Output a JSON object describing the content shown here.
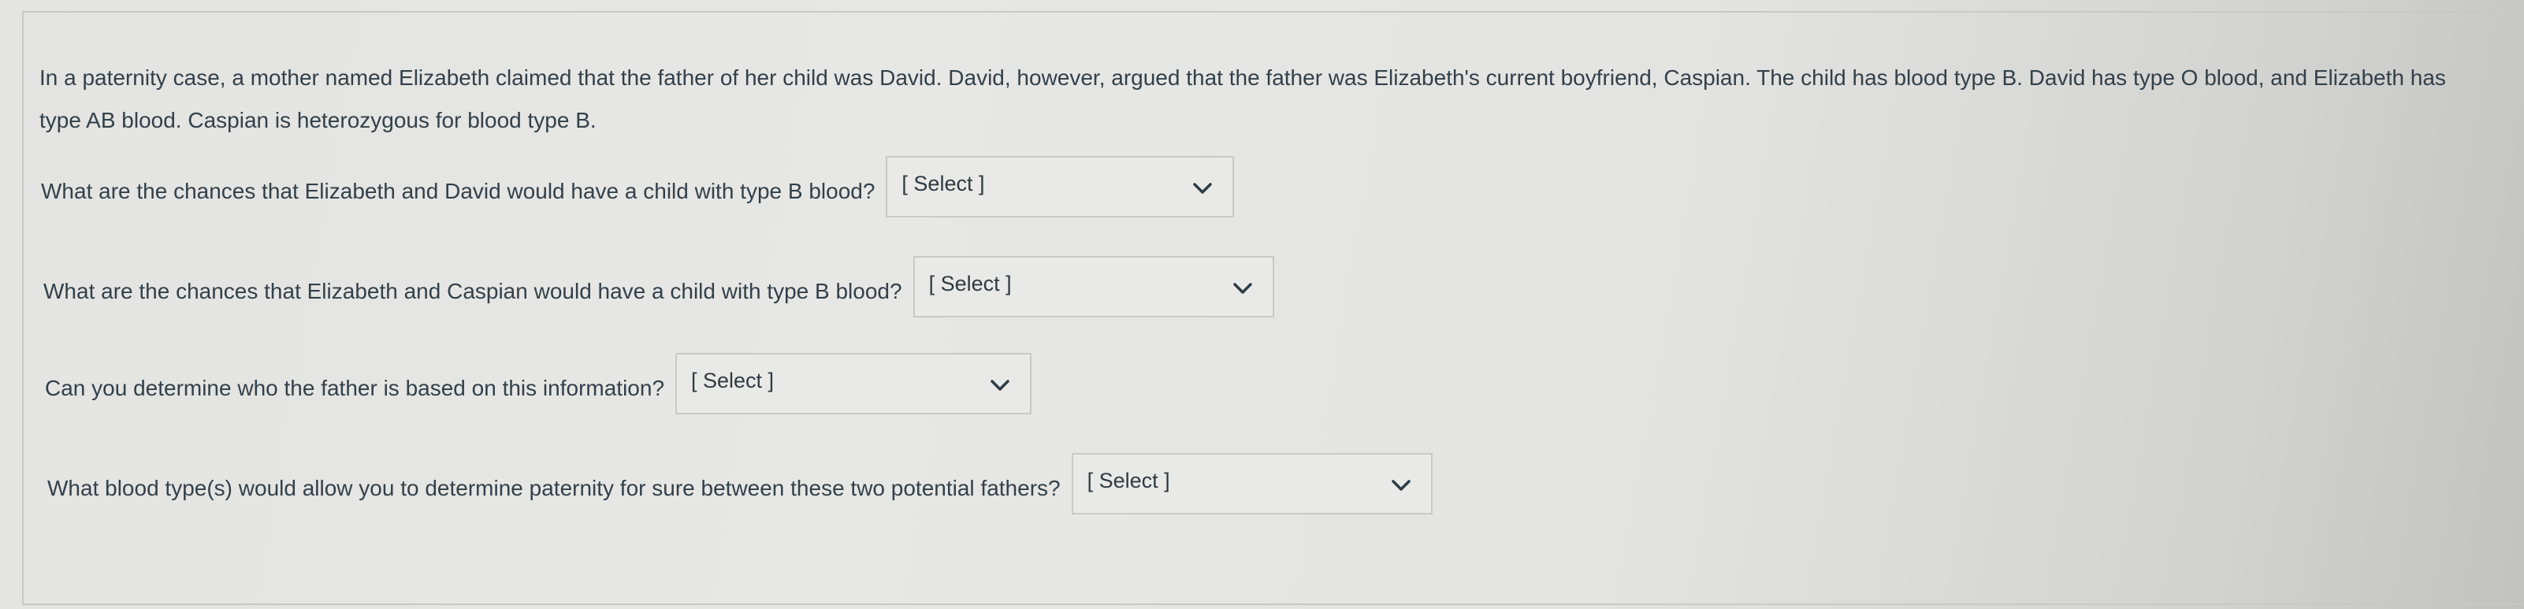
{
  "question": {
    "prompt": "In a paternity case, a mother named Elizabeth claimed that the father of her child was David. David, however, argued that the father was Elizabeth's current boyfriend, Caspian. The child has blood type B. David has type O blood, and Elizabeth has type AB blood. Caspian is heterozygous for blood type B.",
    "items": [
      {
        "text": "What are the chances that Elizabeth and David would have a child with type B blood?",
        "selected": "[ Select ]"
      },
      {
        "text": "What are the chances that Elizabeth and Caspian would have a child with type B blood?",
        "selected": "[ Select ]"
      },
      {
        "text": "Can you determine who the father is based on this information?",
        "selected": "[ Select ]"
      },
      {
        "text": "What blood type(s) would allow you to determine paternity for sure between these two potential fathers?",
        "selected": "[ Select ]"
      }
    ]
  },
  "icons": {
    "dropdown": "chevron-down-icon"
  }
}
